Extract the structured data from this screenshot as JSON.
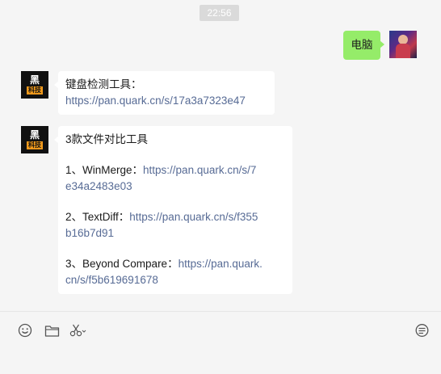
{
  "timestamp": "22:56",
  "colors": {
    "self_bubble": "#95ec69",
    "link": "#576b95",
    "background": "#f5f5f5"
  },
  "messages": [
    {
      "sender": "self",
      "avatar_icon": "user-profile-avatar",
      "text": "电脑"
    },
    {
      "sender": "other",
      "avatar": {
        "glyph": "黑",
        "tag": "科技"
      },
      "text": "键盘检测工具：",
      "link": "https://pan.quark.cn/s/17a3a7323e47"
    },
    {
      "sender": "other",
      "avatar": {
        "glyph": "黑",
        "tag": "科技"
      },
      "title": "3款文件对比工具",
      "items": [
        {
          "label": "1、WinMerge：",
          "link_line1": "https://pan.quark.cn/s/7",
          "link_line2": "e34a2483e03"
        },
        {
          "label": "2、TextDiff：",
          "link_line1": "https://pan.quark.cn/s/f355",
          "link_line2": "b16b7d91"
        },
        {
          "label": "3、Beyond Compare：",
          "link_line1": "https://pan.quark.",
          "link_line2": "cn/s/f5b619691678"
        }
      ]
    }
  ],
  "toolbar": {
    "left_icons": [
      "emoji-icon",
      "folder-icon",
      "scissors-icon"
    ],
    "right_icons": [
      "chat-history-icon"
    ]
  }
}
